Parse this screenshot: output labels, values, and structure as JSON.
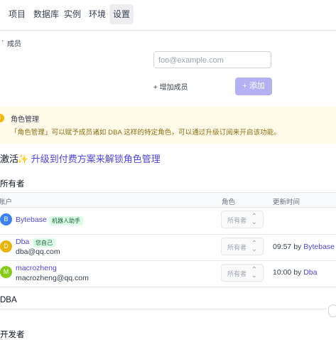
{
  "nav": {
    "tabs": [
      "项目",
      "数据库",
      "实例",
      "环境",
      "设置"
    ],
    "active_index": 4
  },
  "members": {
    "section_label": "成员",
    "email_placeholder": "foo@example.com",
    "add_member_label": "+ 增加成员",
    "add_button_label": "+ 添加"
  },
  "alert": {
    "title": "角色管理",
    "body": "「角色管理」可以赋予成员诸如 DBA 这样的特定角色，可以通过升级订阅来开启该功能。"
  },
  "upgrade": {
    "prefix": "激活",
    "link": "✨ 升级到付费方案来解锁角色管理"
  },
  "owners": {
    "title": "所有者",
    "columns": [
      "账户",
      "角色",
      "更新时间"
    ],
    "rows": [
      {
        "initial": "B",
        "avatar_color": "#3b82f6",
        "name": "Bytebase",
        "badge": "机器人助手",
        "email": "",
        "role": "所有者",
        "time": "",
        "by_label": "",
        "by": ""
      },
      {
        "initial": "D",
        "avatar_color": "#eab308",
        "name": "Dba",
        "badge": "您自己",
        "email": "dba@qq.com",
        "role": "所有者",
        "time": "09:57",
        "by_label": "by",
        "by": "Bytebase"
      },
      {
        "initial": "M",
        "avatar_color": "#84cc16",
        "name": "macrozheng",
        "badge": "",
        "email": "macrozheng@qq.com",
        "role": "所有者",
        "time": "10:00",
        "by_label": "by",
        "by": "Dba"
      }
    ]
  },
  "dba": {
    "title": "DBA"
  },
  "developers": {
    "title": "开发者"
  }
}
